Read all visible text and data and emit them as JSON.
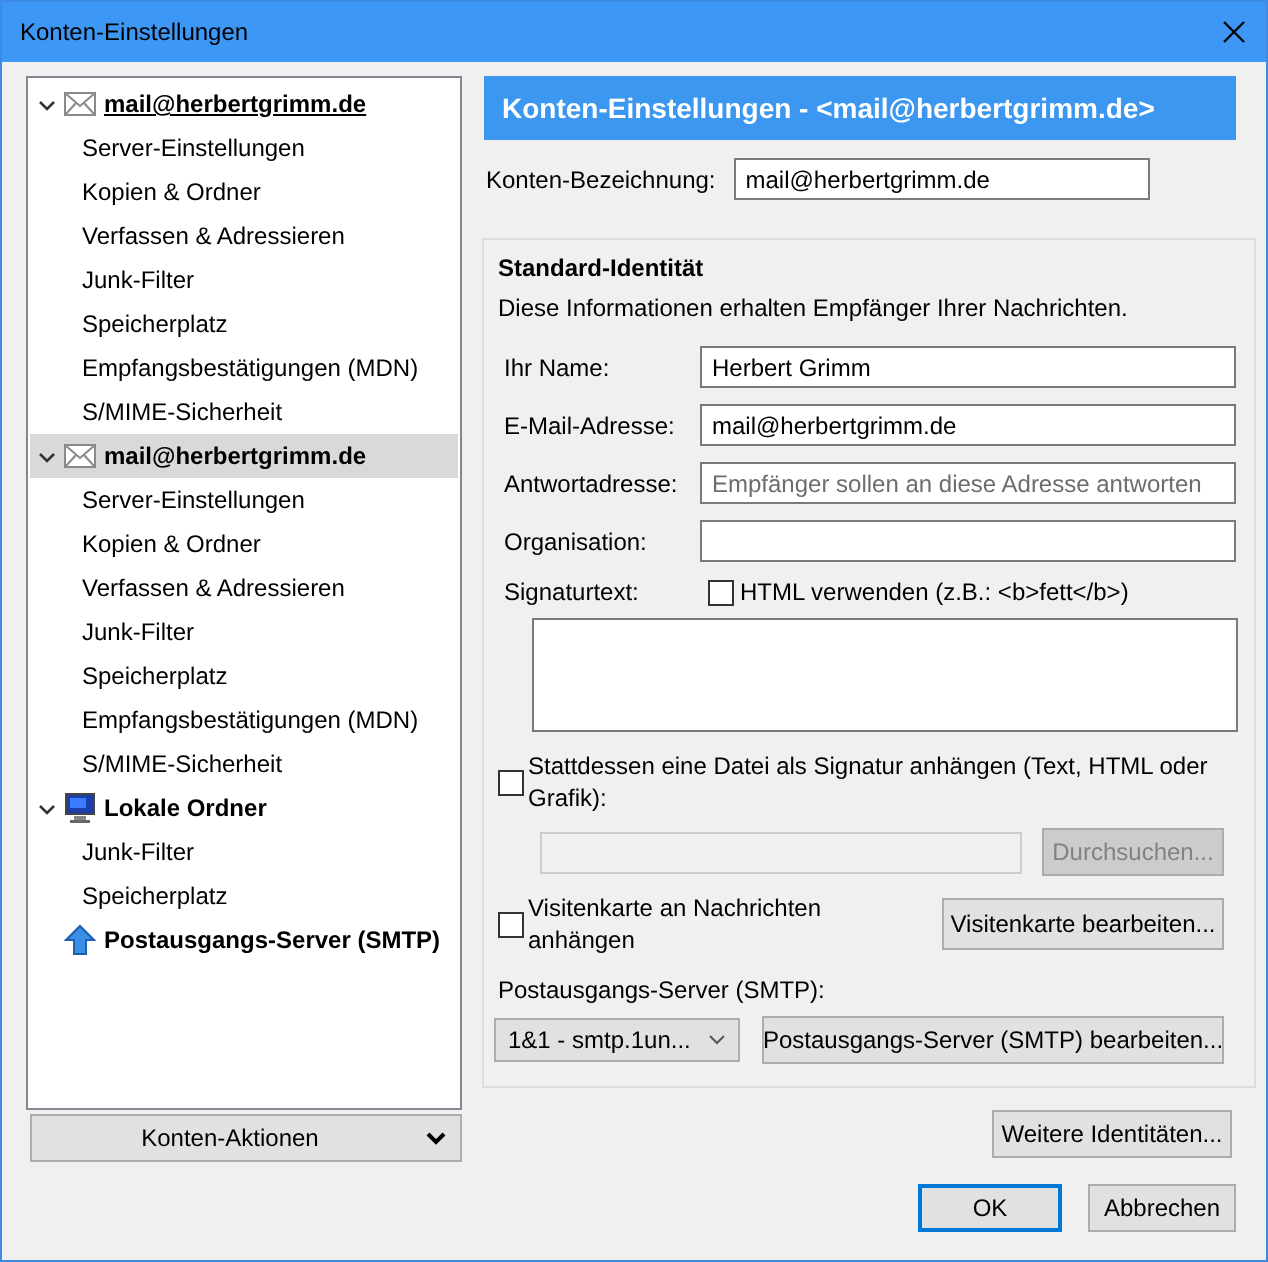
{
  "window": {
    "title": "Konten-Einstellungen"
  },
  "account_tree": [
    {
      "kind": "mail",
      "label": "mail@herbertgrimm.de",
      "expanded": true,
      "selected": false,
      "focused": true,
      "children": [
        {
          "label": "Server-Einstellungen",
          "selected": false
        },
        {
          "label": "Kopien & Ordner",
          "selected": false
        },
        {
          "label": "Verfassen & Adressieren",
          "selected": false
        },
        {
          "label": "Junk-Filter",
          "selected": false
        },
        {
          "label": "Speicherplatz",
          "selected": false
        },
        {
          "label": "Empfangsbestätigungen (MDN)",
          "selected": false
        },
        {
          "label": "S/MIME-Sicherheit",
          "selected": false
        }
      ]
    },
    {
      "kind": "mail",
      "label": "mail@herbertgrimm.de",
      "expanded": true,
      "selected": true,
      "focused": false,
      "children": [
        {
          "label": "Server-Einstellungen",
          "selected": false
        },
        {
          "label": "Kopien & Ordner",
          "selected": false
        },
        {
          "label": "Verfassen & Adressieren",
          "selected": false
        },
        {
          "label": "Junk-Filter",
          "selected": false
        },
        {
          "label": "Speicherplatz",
          "selected": false
        },
        {
          "label": "Empfangsbestätigungen (MDN)",
          "selected": false
        },
        {
          "label": "S/MIME-Sicherheit",
          "selected": false
        }
      ]
    },
    {
      "kind": "local",
      "label": "Lokale Ordner",
      "expanded": true,
      "selected": false,
      "focused": false,
      "children": [
        {
          "label": "Junk-Filter",
          "selected": false
        },
        {
          "label": "Speicherplatz",
          "selected": false
        }
      ]
    },
    {
      "kind": "smtp",
      "label": "Postausgangs-Server (SMTP)",
      "selected": false,
      "focused": false
    }
  ],
  "account_actions": {
    "label": "Konten-Aktionen"
  },
  "header": "Konten-Einstellungen - <mail@herbertgrimm.de>",
  "account_name": {
    "label": "Konten-Bezeichnung:",
    "value": "mail@herbertgrimm.de"
  },
  "identity": {
    "title": "Standard-Identität",
    "description": "Diese Informationen erhalten Empfänger Ihrer Nachrichten.",
    "fields": [
      {
        "label": "Ihr Name:",
        "value": "Herbert Grimm"
      },
      {
        "label": "E-Mail-Adresse:",
        "value": "mail@herbertgrimm.de"
      },
      {
        "label": "Antwortadresse:",
        "placeholder": "Empfänger sollen an diese Adresse antworten"
      },
      {
        "label": "Organisation:"
      }
    ],
    "signature": {
      "label": "Signaturtext:",
      "html_option": {
        "label": "HTML verwenden (z.B.: <b>fett</b>)",
        "checked": false
      }
    },
    "attach_file": {
      "label": "Stattdessen eine Datei als Signatur anhängen (Text, HTML oder Grafik):",
      "checked": false
    },
    "file_path": {
      "disabled": true
    },
    "browse_button": {
      "label": "Durchsuchen...",
      "disabled": true
    },
    "vcard": {
      "label": "Visitenkarte an Nachrichten anhängen",
      "checked": false
    },
    "vcard_button": {
      "label": "Visitenkarte bearbeiten..."
    },
    "smtp": {
      "label": "Postausgangs-Server (SMTP):",
      "value": "1&1 - smtp.1un...",
      "button": "Postausgangs-Server (SMTP) bearbeiten..."
    }
  },
  "more_identities": {
    "label": "Weitere Identitäten..."
  },
  "buttons": [
    {
      "label": "OK",
      "default": true
    },
    {
      "label": "Abbrechen",
      "default": false
    }
  ]
}
